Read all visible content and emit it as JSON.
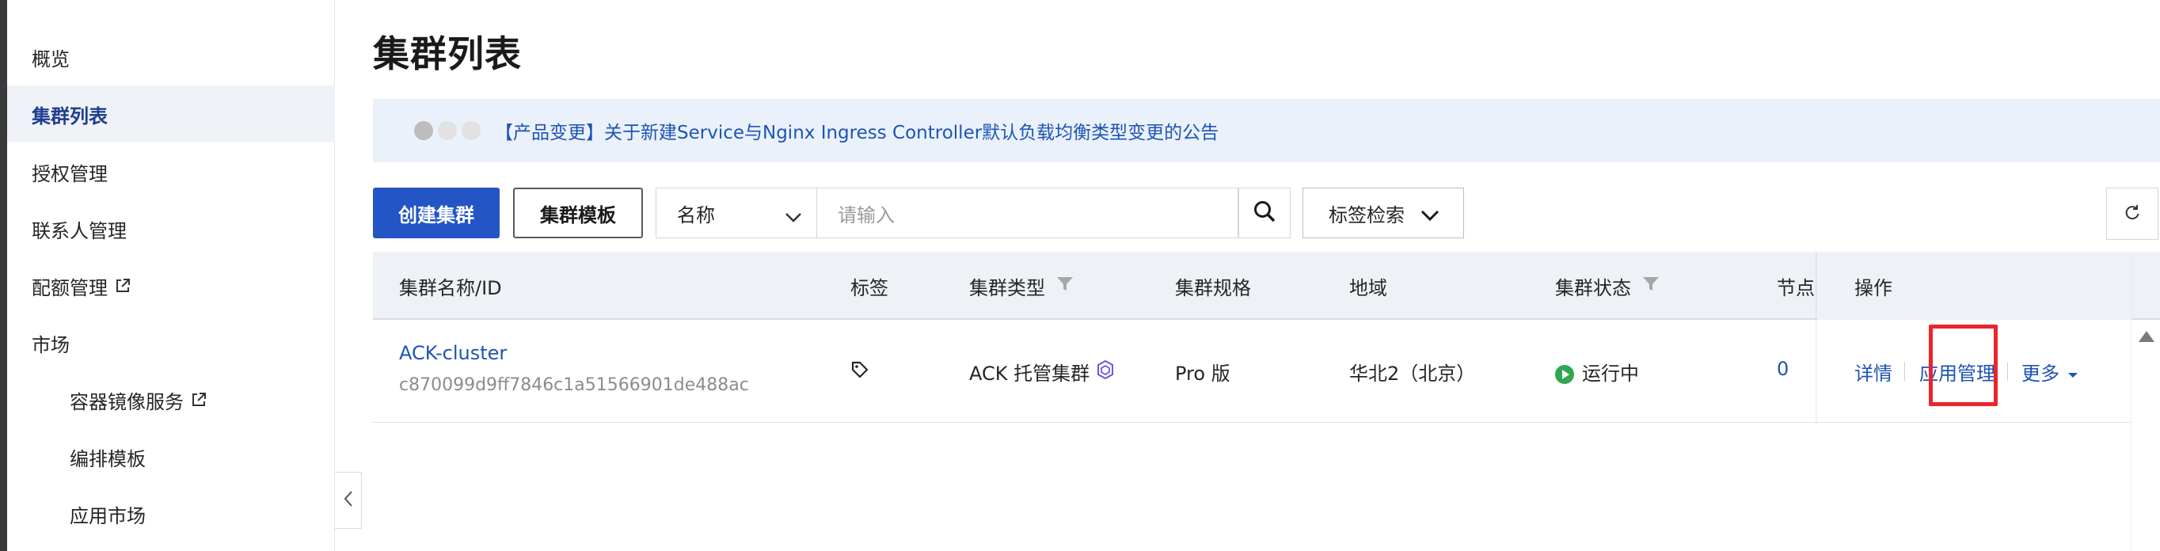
{
  "sidebar": {
    "items": [
      {
        "label": "概览"
      },
      {
        "label": "集群列表"
      },
      {
        "label": "授权管理"
      },
      {
        "label": "联系人管理"
      },
      {
        "label": "配额管理"
      },
      {
        "label": "市场"
      },
      {
        "label": "容器镜像服务"
      },
      {
        "label": "编排模板"
      },
      {
        "label": "应用市场"
      }
    ]
  },
  "page": {
    "title": "集群列表"
  },
  "banner": {
    "text": "【产品变更】关于新建Service与Nginx Ingress Controller默认负载均衡类型变更的公告"
  },
  "toolbar": {
    "create_label": "创建集群",
    "template_label": "集群模板",
    "select_value": "名称",
    "search_placeholder": "请输入",
    "tag_search_label": "标签检索"
  },
  "table": {
    "columns": {
      "name": "集群名称/ID",
      "tags": "标签",
      "type": "集群类型",
      "spec": "集群规格",
      "region": "地域",
      "status": "集群状态",
      "nodes": "节点",
      "ops": "操作"
    },
    "rows": [
      {
        "name": "ACK-cluster",
        "id": "c870099d9ff7846c1a51566901de488ac",
        "type": "ACK 托管集群",
        "spec": "Pro 版",
        "region": "华北2（北京）",
        "status": "运行中",
        "nodes": "0",
        "actions": {
          "detail": "详情",
          "app_manage": "应用管理",
          "more": "更多"
        }
      }
    ]
  },
  "colors": {
    "primary": "#2355c4",
    "link": "#1e54b4",
    "status_running": "#2fa84f",
    "highlight": "#e8262b"
  }
}
